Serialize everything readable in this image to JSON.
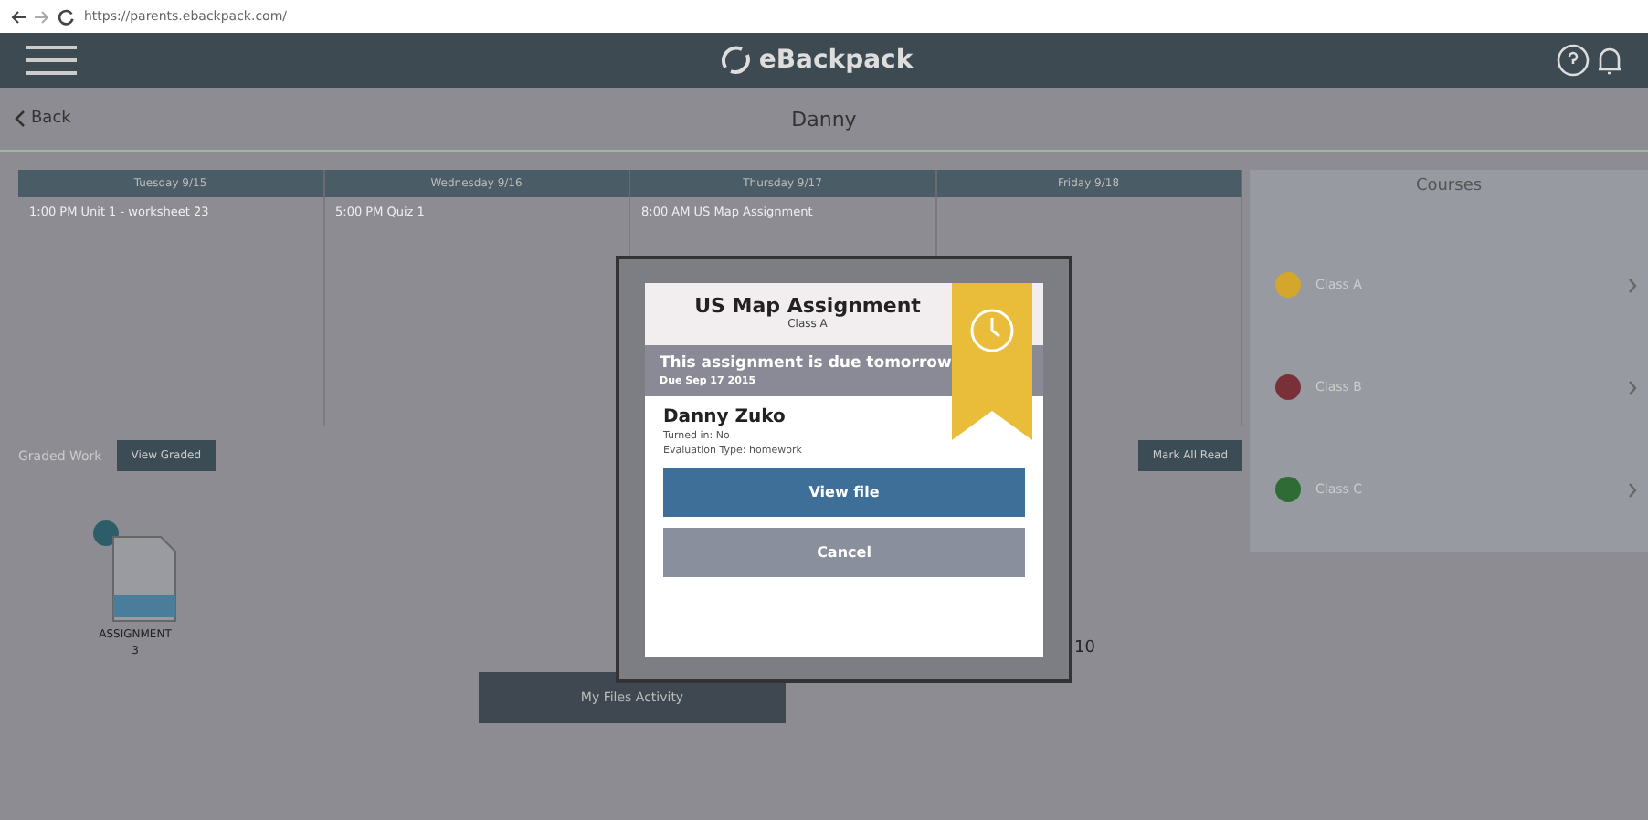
{
  "browser": {
    "url": "https://parents.ebackpack.com/"
  },
  "header": {
    "logo": "eBackpack"
  },
  "subheader": {
    "back": "Back",
    "title": "Danny"
  },
  "calendar": {
    "days": [
      {
        "heading": "Tuesday 9/15",
        "entry": "1:00 PM Unit 1 - worksheet 23"
      },
      {
        "heading": "Wednesday 9/16",
        "entry": "5:00 PM Quiz 1"
      },
      {
        "heading": "Thursday 9/17",
        "entry": "8:00 AM US Map Assignment"
      },
      {
        "heading": "Friday 9/18"
      }
    ]
  },
  "courses": {
    "title": "Courses",
    "items": [
      {
        "name": "Class A",
        "color": "#d4a72c"
      },
      {
        "name": "Class B",
        "color": "#7a3038"
      },
      {
        "name": "Class C",
        "color": "#2e6b35"
      }
    ]
  },
  "graded_work": {
    "label": "Graded Work",
    "view_button": "View Graded",
    "mark_button": "Mark All Read",
    "assignment": {
      "label": "ASSIGNMENT",
      "count": "3"
    },
    "total": "10"
  },
  "activity_button": "My Files Activity",
  "modal": {
    "title": "US Map Assignment",
    "class": "Class A",
    "notice": "This assignment is due tomorrow",
    "due": "Due Sep 17 2015",
    "student": "Danny Zuko",
    "turned_in": "Turned in: No",
    "evaluation": "Evaluation Type: homework",
    "buttons": [
      {
        "label": "View file",
        "kind": "primary"
      },
      {
        "label": "Cancel",
        "kind": "secondary"
      }
    ]
  }
}
